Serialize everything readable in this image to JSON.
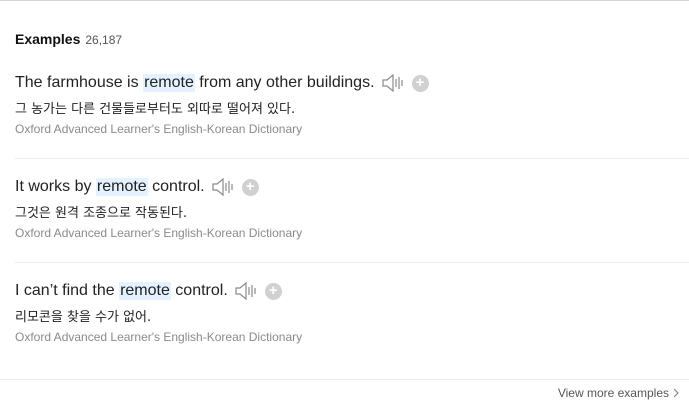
{
  "header": {
    "title": "Examples",
    "count": "26,187"
  },
  "examples": [
    {
      "pre": "The farmhouse is ",
      "highlight": "remote",
      "post": " from any other buildings.",
      "korean": "그 농가는 다른 건물들로부터도 외따로 떨어져 있다.",
      "source": "Oxford Advanced Learner's English-Korean Dictionary"
    },
    {
      "pre": "It works by ",
      "highlight": "remote",
      "post": " control.",
      "korean": "그것은 원격 조종으로 작동된다.",
      "source": "Oxford Advanced Learner's English-Korean Dictionary"
    },
    {
      "pre": "I can’t find the ",
      "highlight": "remote",
      "post": " control.",
      "korean": "리모콘을 찾을 수가 없어.",
      "source": "Oxford Advanced Learner's English-Korean Dictionary"
    }
  ],
  "icons": {
    "speaker": "speaker-icon",
    "add": "plus-circle-icon",
    "chevron": "chevron-right-icon"
  },
  "colors": {
    "highlight": "#e4f1ff",
    "source_text": "#8a8a8a",
    "icon_gray": "#d0d0d0"
  },
  "footer": {
    "view_more": "View more examples"
  },
  "glyphs": {
    "plus": "+"
  }
}
